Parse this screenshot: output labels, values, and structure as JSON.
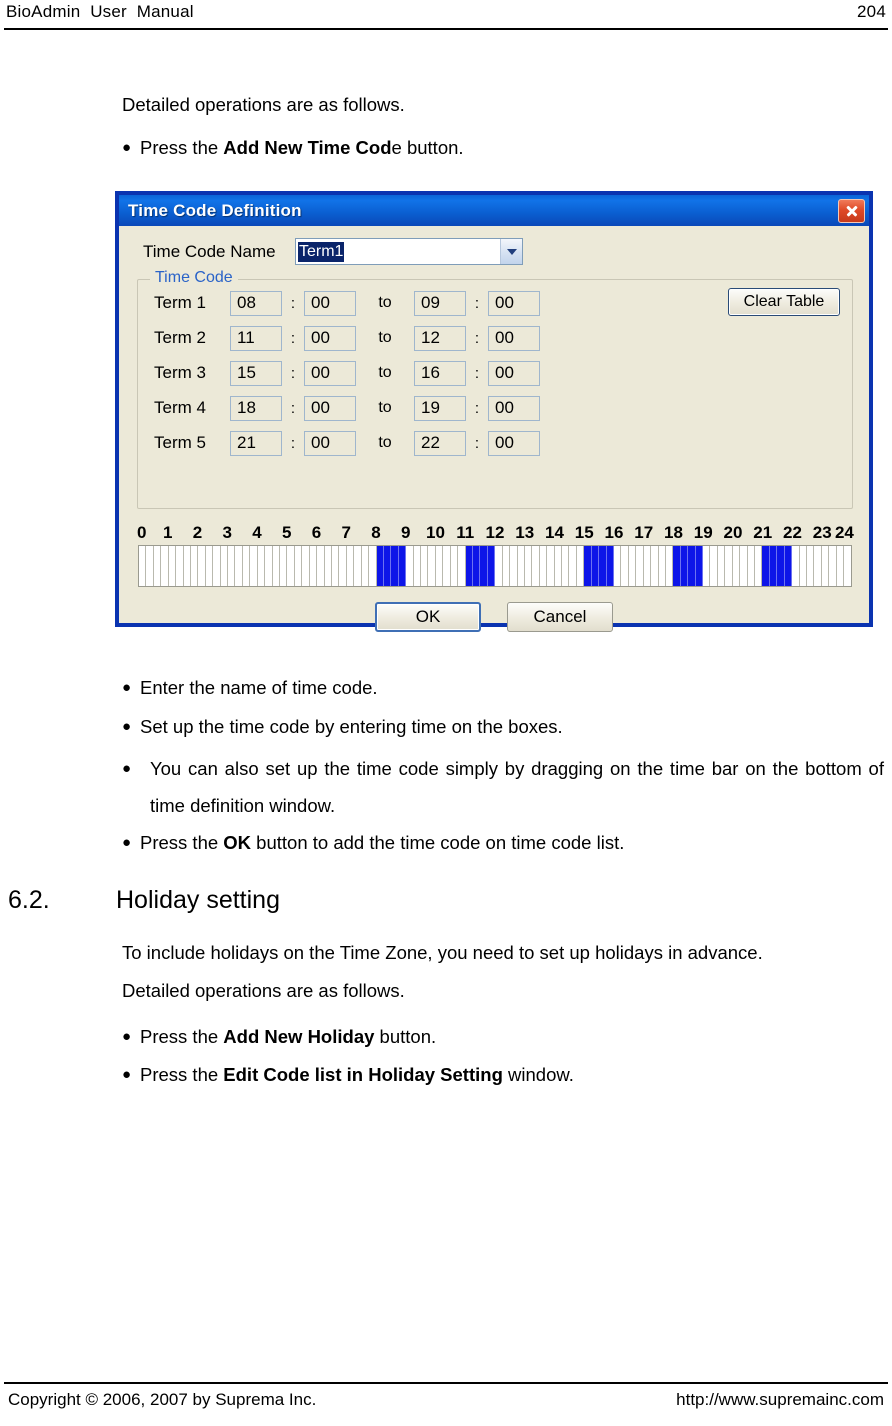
{
  "header": {
    "title": "BioAdmin  User  Manual",
    "page_number": "204"
  },
  "footer": {
    "copyright": "Copyright © 2006, 2007 by Suprema Inc.",
    "url": "http://www.supremainc.com"
  },
  "intro": {
    "lead": "Detailed operations are as follows.",
    "bullet_press_prefix": "Press the ",
    "bullet_press_bold": "Add New Time Cod",
    "bullet_press_suffix": "e button."
  },
  "dialog": {
    "title": "Time Code Definition",
    "close_icon": "close-icon",
    "name_label": "Time Code Name",
    "name_value": "Term1",
    "dropdown_icon": "chevron-down-icon",
    "group_legend": "Time Code",
    "clear_button": "Clear Table",
    "to_separator": "to",
    "colon": ":",
    "terms": [
      {
        "label": "Term 1",
        "start_hour": "08",
        "start_min": "00",
        "end_hour": "09",
        "end_min": "00"
      },
      {
        "label": "Term 2",
        "start_hour": "11",
        "start_min": "00",
        "end_hour": "12",
        "end_min": "00"
      },
      {
        "label": "Term 3",
        "start_hour": "15",
        "start_min": "00",
        "end_hour": "16",
        "end_min": "00"
      },
      {
        "label": "Term 4",
        "start_hour": "18",
        "start_min": "00",
        "end_hour": "19",
        "end_min": "00"
      },
      {
        "label": "Term 5",
        "start_hour": "21",
        "start_min": "00",
        "end_hour": "22",
        "end_min": "00"
      }
    ],
    "ruler_labels": [
      "0",
      "1",
      "2",
      "3",
      "4",
      "5",
      "6",
      "7",
      "8",
      "9",
      "10",
      "11",
      "12",
      "13",
      "14",
      "15",
      "16",
      "17",
      "18",
      "19",
      "20",
      "21",
      "22",
      "23",
      "24"
    ],
    "timebar": {
      "cells_per_hour": 4,
      "total_cells": 96,
      "selected_ranges": [
        [
          8,
          9
        ],
        [
          11,
          12
        ],
        [
          15,
          16
        ],
        [
          18,
          19
        ],
        [
          21,
          22
        ]
      ],
      "selected_color": "#0d15e8",
      "empty_color": "#ffffff"
    },
    "ok_button": "OK",
    "cancel_button": "Cancel"
  },
  "steps": [
    {
      "prefix": "Enter the name of time code.",
      "bold": "",
      "suffix": ""
    },
    {
      "prefix": "Set up the time code by entering time on the boxes.",
      "bold": "",
      "suffix": ""
    },
    {
      "prefix": "You can also set up the time code simply by dragging on the time bar on the bottom of time definition window.",
      "bold": "",
      "suffix": ""
    },
    {
      "prefix": "Press the ",
      "bold": "OK",
      "suffix": " button to add the time code on time code list."
    }
  ],
  "section": {
    "number": "6.2.",
    "title": "Holiday setting",
    "paragraph1": "To include holidays on the Time Zone, you need to set up holidays in advance.",
    "paragraph2": "Detailed operations are as follows.",
    "bullets": [
      {
        "prefix": "Press the ",
        "bold": "Add New Holiday",
        "suffix": " button."
      },
      {
        "prefix": "Press the ",
        "bold": "Edit Code list in Holiday Setting",
        "suffix": " window."
      }
    ]
  },
  "bullet_glyph": "●"
}
